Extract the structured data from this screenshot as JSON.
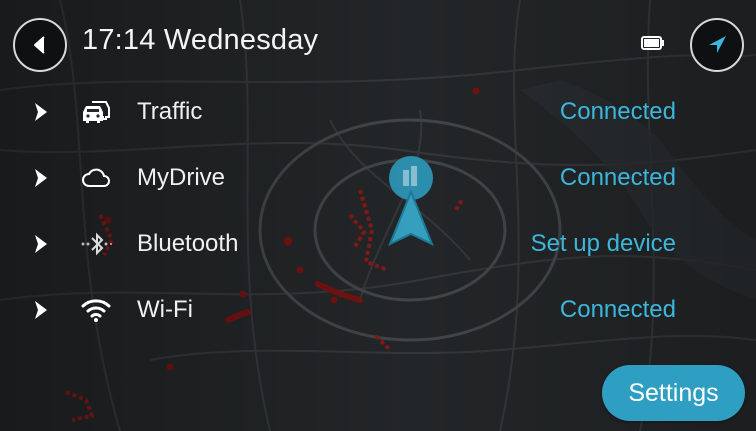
{
  "header": {
    "time_day": "17:14 Wednesday",
    "back_icon": "arrow-left-icon",
    "battery_icon": "battery-icon",
    "current_location_icon": "navigation-arrow-icon"
  },
  "status_list": {
    "items": [
      {
        "label": "Traffic",
        "status": "Connected",
        "icon": "traffic-car-icon"
      },
      {
        "label": "MyDrive",
        "status": "Connected",
        "icon": "cloud-icon"
      },
      {
        "label": "Bluetooth",
        "status": "Set up device",
        "icon": "bluetooth-icon"
      },
      {
        "label": "Wi-Fi",
        "status": "Connected",
        "icon": "wifi-icon"
      }
    ]
  },
  "footer": {
    "settings_label": "Settings"
  },
  "colors": {
    "accent": "#3cb6da",
    "button": "#2f9ec3",
    "traffic": "#7a1313",
    "map_bg": "#232527"
  }
}
